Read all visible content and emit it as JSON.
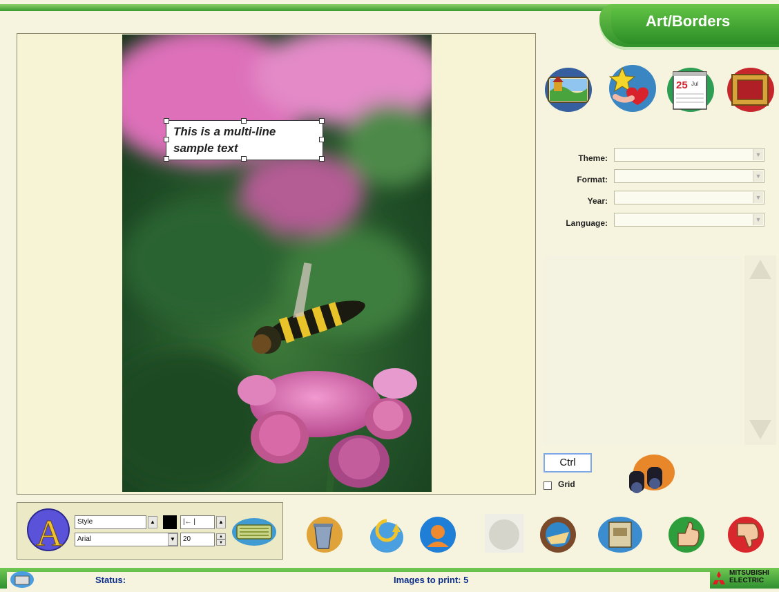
{
  "header": {
    "title": "Art/Borders"
  },
  "canvas": {
    "text_box": {
      "line1": "This is a multi-line",
      "line2": "sample text"
    }
  },
  "categories": [
    {
      "icon": "landscape-scene-icon"
    },
    {
      "icon": "star-heart-icon"
    },
    {
      "icon": "calendar-icon",
      "day": "25",
      "month": "Jul"
    },
    {
      "icon": "picture-frame-icon"
    }
  ],
  "filters": {
    "theme": {
      "label": "Theme:",
      "value": ""
    },
    "format": {
      "label": "Format:",
      "value": ""
    },
    "year": {
      "label": "Year:",
      "value": ""
    },
    "language": {
      "label": "Language:",
      "value": ""
    }
  },
  "ctrl_label": "Ctrl",
  "grid": {
    "label": "Grid",
    "checked": false
  },
  "text_tools": {
    "style_value": "Style",
    "font_value": "Arial",
    "size_value": "20",
    "align_value": "|←    |"
  },
  "status": {
    "label": "Status:",
    "images_to_print": "Images to print: 5",
    "brand_line1": "MITSUBISHI",
    "brand_line2": "ELECTRIC"
  },
  "colors": {
    "accent_green": "#3a9b2e",
    "status_text": "#0b2d8a",
    "panel_bg": "#f6f4de"
  }
}
